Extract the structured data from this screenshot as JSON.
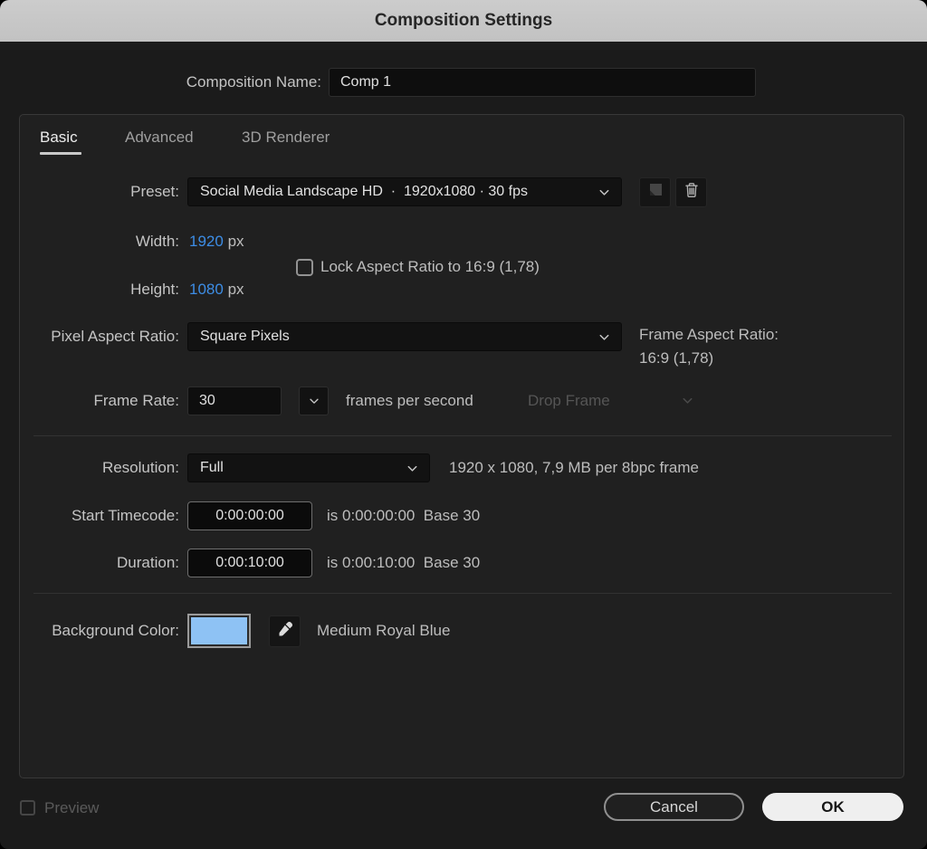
{
  "title_bar": {
    "title": "Composition Settings"
  },
  "name_row": {
    "label": "Composition Name:",
    "value": "Comp 1"
  },
  "tabs": {
    "basic": "Basic",
    "advanced": "Advanced",
    "renderer": "3D Renderer"
  },
  "preset_row": {
    "label": "Preset:",
    "value": "Social Media Landscape HD  ·  1920x1080 · 30 fps"
  },
  "dimensions": {
    "width_label": "Width:",
    "width_value": "1920",
    "width_unit": "px",
    "height_label": "Height:",
    "height_value": "1080",
    "height_unit": "px",
    "lock_aspect_label": "Lock Aspect Ratio to 16:9 (1,78)"
  },
  "pixel_aspect_row": {
    "label": "Pixel Aspect Ratio:",
    "value": "Square Pixels",
    "frame_aspect_label": "Frame Aspect Ratio:",
    "frame_aspect_value": "16:9 (1,78)"
  },
  "frame_rate_row": {
    "label": "Frame Rate:",
    "value": "30",
    "suffix": "frames per second",
    "drop_frame_label": "Drop Frame"
  },
  "resolution_row": {
    "label": "Resolution:",
    "value": "Full",
    "info": "1920 x 1080, 7,9 MB per 8bpc frame"
  },
  "start_timecode_row": {
    "label": "Start Timecode:",
    "value": "0:00:00:00",
    "info": "is 0:00:00:00  Base 30"
  },
  "duration_row": {
    "label": "Duration:",
    "value": "0:00:10:00",
    "info": "is 0:00:10:00  Base 30"
  },
  "background_row": {
    "label": "Background Color:",
    "color_name": "Medium Royal Blue",
    "swatch_color": "#8ec2f4"
  },
  "footer": {
    "preview_label": "Preview",
    "cancel_label": "Cancel",
    "ok_label": "OK"
  },
  "icons": {
    "preset_dropdown": "chevron-down-icon",
    "save_preset": "save-preset-icon",
    "delete_preset": "trash-icon",
    "eyedropper": "eyedropper-icon"
  },
  "colors": {
    "accent_blue": "#3d8de5",
    "background_swatch": "#8ec2f4",
    "titlebar_bg": "#c6c6c6"
  }
}
